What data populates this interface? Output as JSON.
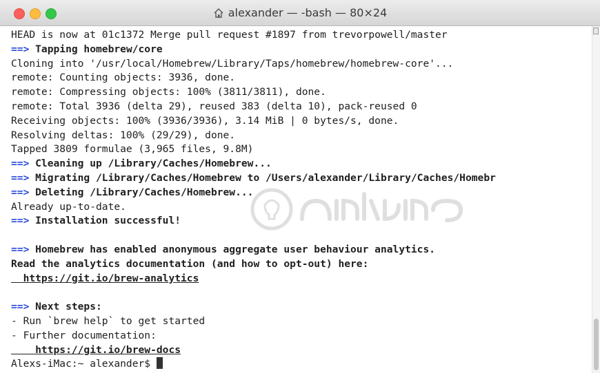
{
  "window": {
    "title": "alexander — -bash — 80×24"
  },
  "terminal": {
    "lines": [
      {
        "arrow": "",
        "text": "HEAD is now at 01c1372 Merge pull request #1897 from trevorpowell/master",
        "style": "plain"
      },
      {
        "arrow": "==>",
        "text": " Tapping homebrew/core",
        "style": "bold"
      },
      {
        "arrow": "",
        "text": "Cloning into '/usr/local/Homebrew/Library/Taps/homebrew/homebrew-core'...",
        "style": "plain"
      },
      {
        "arrow": "",
        "text": "remote: Counting objects: 3936, done.",
        "style": "plain"
      },
      {
        "arrow": "",
        "text": "remote: Compressing objects: 100% (3811/3811), done.",
        "style": "plain"
      },
      {
        "arrow": "",
        "text": "remote: Total 3936 (delta 29), reused 383 (delta 10), pack-reused 0",
        "style": "plain"
      },
      {
        "arrow": "",
        "text": "Receiving objects: 100% (3936/3936), 3.14 MiB | 0 bytes/s, done.",
        "style": "plain"
      },
      {
        "arrow": "",
        "text": "Resolving deltas: 100% (29/29), done.",
        "style": "plain"
      },
      {
        "arrow": "",
        "text": "Tapped 3809 formulae (3,965 files, 9.8M)",
        "style": "plain"
      },
      {
        "arrow": "==>",
        "text": " Cleaning up /Library/Caches/Homebrew...",
        "style": "bold"
      },
      {
        "arrow": "==>",
        "text": " Migrating /Library/Caches/Homebrew to /Users/alexander/Library/Caches/Homebr",
        "style": "bold"
      },
      {
        "arrow": "==>",
        "text": " Deleting /Library/Caches/Homebrew...",
        "style": "bold"
      },
      {
        "arrow": "",
        "text": "Already up-to-date.",
        "style": "plain"
      },
      {
        "arrow": "==>",
        "text": " Installation successful!",
        "style": "bold"
      },
      {
        "arrow": "",
        "text": "",
        "style": "plain"
      },
      {
        "arrow": "==>",
        "text": " Homebrew has enabled anonymous aggregate user behaviour analytics.",
        "style": "bold"
      },
      {
        "arrow": "",
        "text": "Read the analytics documentation (and how to opt-out) here:",
        "style": "bold"
      },
      {
        "arrow": "",
        "text": "  https://git.io/brew-analytics",
        "style": "url"
      },
      {
        "arrow": "",
        "text": "",
        "style": "plain"
      },
      {
        "arrow": "==>",
        "text": " Next steps:",
        "style": "bold"
      },
      {
        "arrow": "",
        "text": "- Run `brew help` to get started",
        "style": "plain"
      },
      {
        "arrow": "",
        "text": "- Further documentation:",
        "style": "plain"
      },
      {
        "arrow": "",
        "text": "    https://git.io/brew-docs",
        "style": "url"
      },
      {
        "arrow": "",
        "text": "Alexs-iMac:~ alexander$ ",
        "style": "prompt"
      }
    ]
  },
  "colors": {
    "arrow": "#2a4bd7",
    "text": "#202020",
    "close": "#fc605c",
    "minimize": "#fdbc40",
    "zoom": "#34c84a"
  },
  "icons": {
    "title_icon": "home-icon",
    "watermark": "quantrimang-logo"
  }
}
